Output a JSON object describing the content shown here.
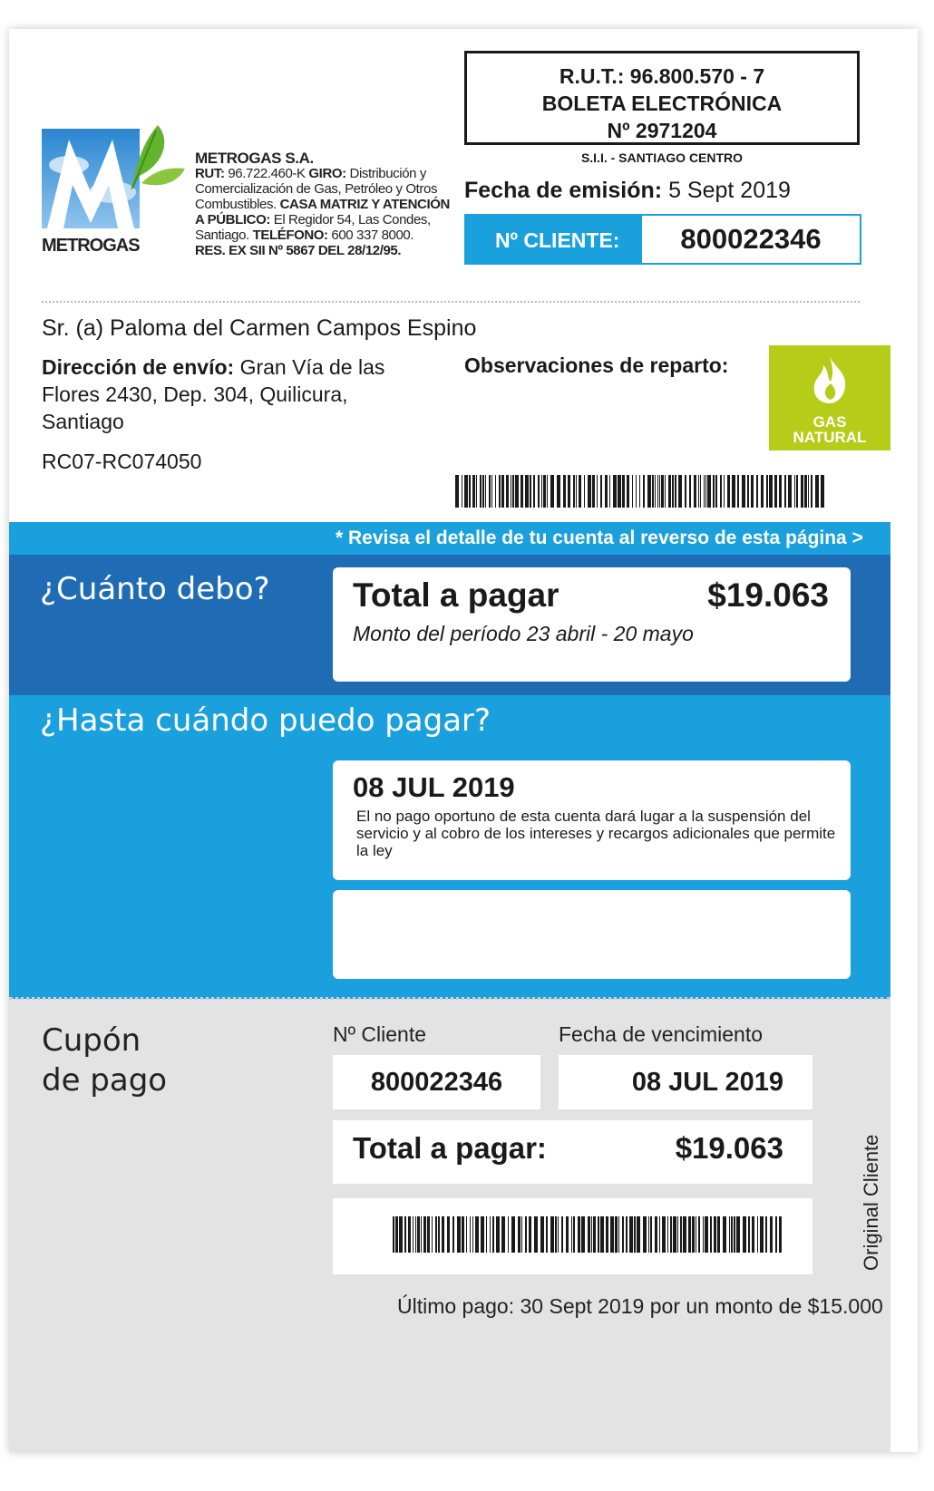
{
  "header": {
    "logo_text": "METROGAS",
    "company": {
      "name": "METROGAS S.A.",
      "rut_label": "RUT:",
      "rut": "96.722.460-K",
      "giro_label": "GIRO:",
      "giro": "Distribución y Comercialización de Gas, Petróleo y Otros Combustibles.",
      "casa_label": "CASA MATRIZ Y ATENCIÓN A PÚBLICO:",
      "casa": "El Regidor 54, Las Condes, Santiago.",
      "telefono_label": "TELÉFONO:",
      "telefono": "600 337 8000.",
      "res": "RES. EX SII Nº 5867 DEL 28/12/95."
    },
    "rut_box": {
      "line1": "R.U.T.: 96.800.570 - 7",
      "line2": "BOLETA ELECTRÓNICA",
      "line3": "Nº 2971204"
    },
    "sii": "S.I.I. - SANTIAGO CENTRO",
    "fecha_label": "Fecha de emisión:",
    "fecha_value": "5 Sept 2019",
    "cliente_label": "Nº CLIENTE:",
    "cliente_value": "800022346"
  },
  "address": {
    "name": "Sr. (a) Paloma del Carmen Campos Espino",
    "dir_label": "Dirección de envío:",
    "dir_value": "Gran Vía de las Flores 2430, Dep. 304, Quilicura, Santiago",
    "route_code": "RC07-RC074050",
    "obs_label": "Observaciones de reparto:",
    "badge_line1": "GAS",
    "badge_line2": "NATURAL"
  },
  "revisa": "* Revisa el detalle de tu cuenta al reverso de esta página  >",
  "debo": {
    "title": "¿Cuánto debo?",
    "total_label": "Total a pagar",
    "total_amount": "$19.063",
    "periodo": "Monto del período 23 abril - 20 mayo"
  },
  "hasta": {
    "title": "¿Hasta cuándo puedo pagar?",
    "date": "08 JUL 2019",
    "note": "El no pago oportuno de esta cuenta dará lugar a la suspensión del servicio y al cobro de los intereses y recargos adicionales que permite la ley"
  },
  "cupon": {
    "title_line1": "Cupón",
    "title_line2": "de pago",
    "cliente_label": "Nº Cliente",
    "cliente_value": "800022346",
    "venc_label": "Fecha de vencimiento",
    "venc_value": "08 JUL 2019",
    "total_label": "Total a pagar:",
    "total_amount": "$19.063",
    "original": "Original Cliente",
    "ultimo_pago": "Último pago: 30 Sept 2019 por un monto de $15.000"
  }
}
